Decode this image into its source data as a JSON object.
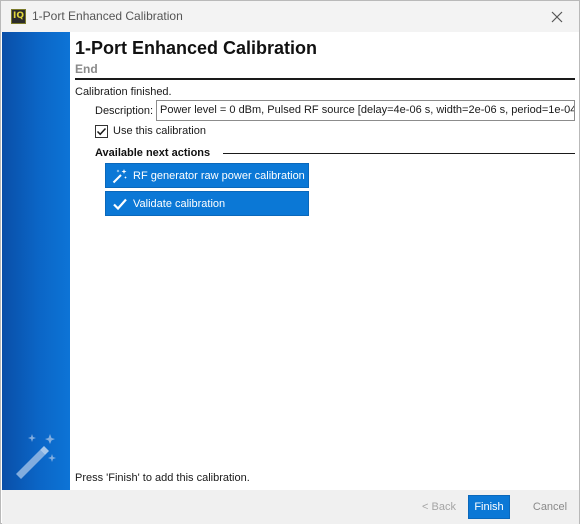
{
  "window": {
    "title": "1-Port Enhanced Calibration",
    "app_icon_text": "IQ"
  },
  "page": {
    "title": "1-Port Enhanced Calibration",
    "subtitle": "End",
    "status": "Calibration finished.",
    "description_label": "Description:",
    "description_value": "Power level = 0 dBm, Pulsed RF source [delay=4e-06 s, width=2e-06 s, period=1e-04",
    "use_calibration_label": "Use this calibration",
    "use_calibration_checked": true,
    "next_actions_header": "Available next actions",
    "actions": [
      {
        "label": "RF generator raw power calibration",
        "icon": "magic-wand-icon"
      },
      {
        "label": "Validate calibration",
        "icon": "checkmark-icon"
      }
    ],
    "footer_hint": "Press 'Finish' to add this calibration."
  },
  "buttons": {
    "back": "< Back",
    "finish": "Finish",
    "cancel": "Cancel"
  },
  "colors": {
    "accent": "#0b78d6",
    "sidebar_dark": "#0a4fa8",
    "sidebar_light": "#0d74d6"
  }
}
